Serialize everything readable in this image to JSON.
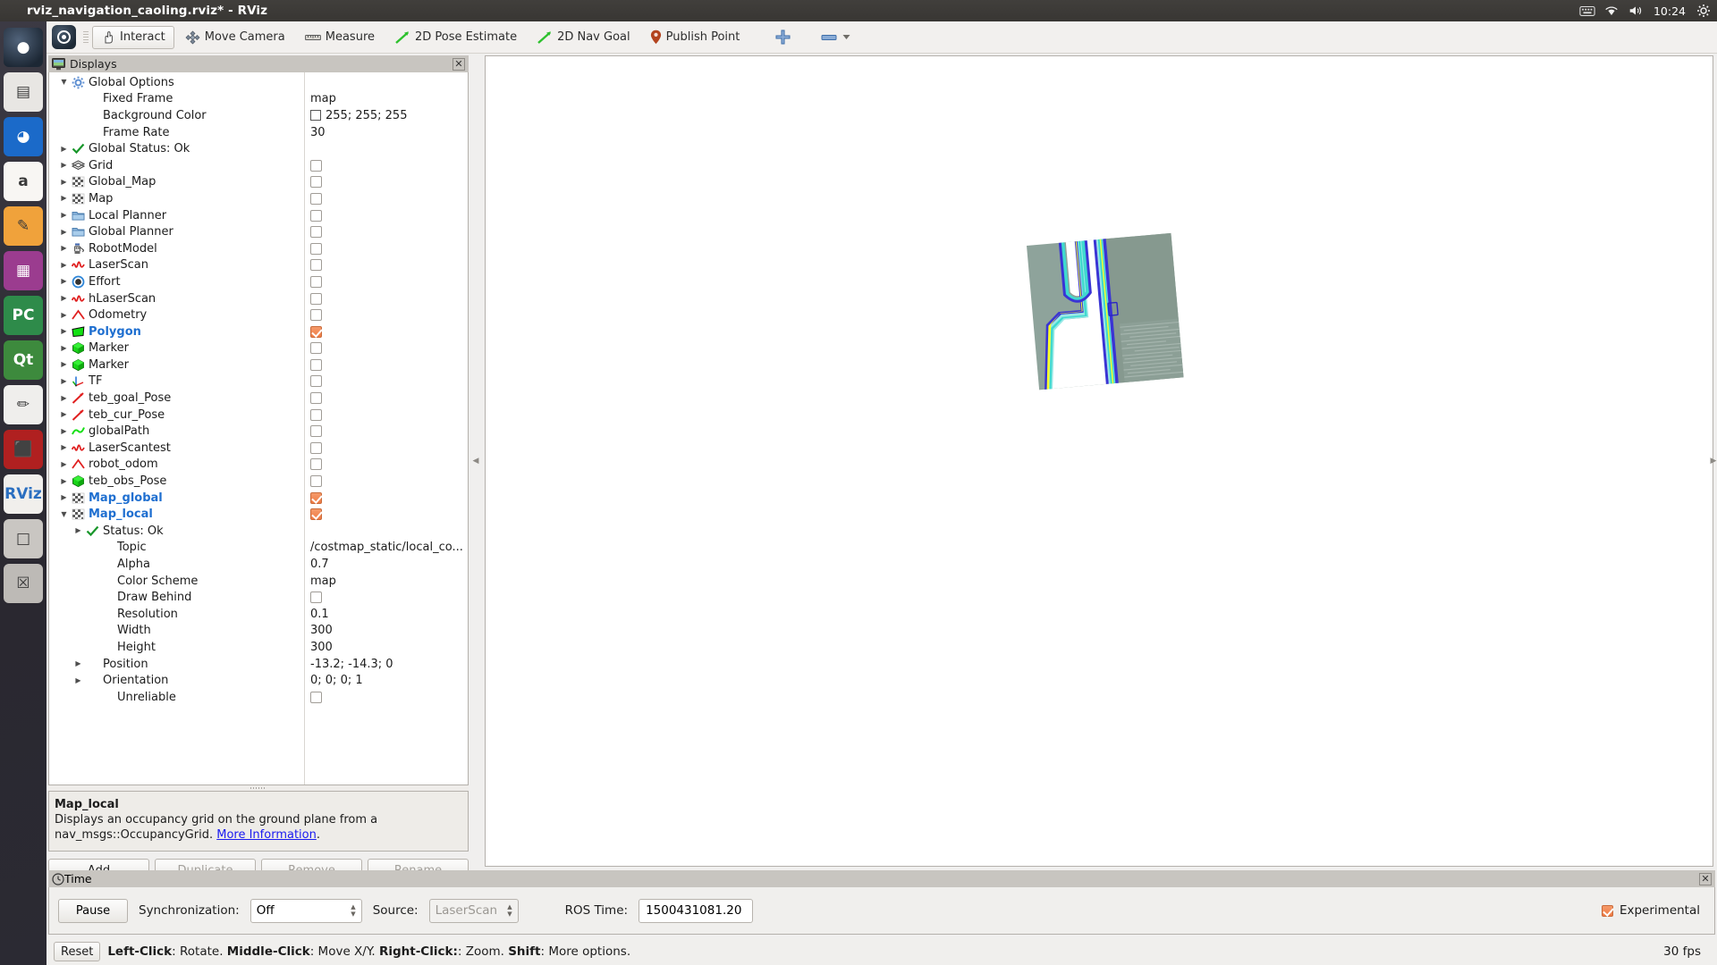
{
  "window": {
    "title": "rviz_navigation_caoling.rviz* - RViz",
    "clock": "10:24"
  },
  "launcher": {
    "items": [
      {
        "name": "ubuntu-dash",
        "label": "●",
        "color": "#3c3b37"
      },
      {
        "name": "files",
        "label": "▤",
        "color": "#e8e6e3"
      },
      {
        "name": "firefox",
        "label": "◕",
        "color": "#1b6ac9"
      },
      {
        "name": "amazon",
        "label": "a",
        "color": "#f8f6f3"
      },
      {
        "name": "software-center",
        "label": "✎",
        "color": "#f0a23b"
      },
      {
        "name": "gallery",
        "label": "▦",
        "color": "#9b3c8f"
      },
      {
        "name": "pycharm",
        "label": "PC",
        "color": "#2e8b4a"
      },
      {
        "name": "qt-creator",
        "label": "Qt",
        "color": "#3d8a3d"
      },
      {
        "name": "text-editor",
        "label": "✏",
        "color": "#efeeec"
      },
      {
        "name": "terminal",
        "label": "⬛",
        "color": "#b02020"
      },
      {
        "name": "rviz-app",
        "label": "RViz",
        "color": "#e9e7e4"
      },
      {
        "name": "archive",
        "label": "□",
        "color": "#c9c6c2"
      },
      {
        "name": "trash",
        "label": "☒",
        "color": "#bdbab6"
      }
    ]
  },
  "toolbar": {
    "buttons": [
      {
        "name": "interact",
        "label": "Interact",
        "icon": "hand-icon",
        "active": true
      },
      {
        "name": "move-camera",
        "label": "Move Camera",
        "icon": "move-camera-icon",
        "active": false
      },
      {
        "name": "measure",
        "label": "Measure",
        "icon": "ruler-icon",
        "active": false
      },
      {
        "name": "2d-pose-estimate",
        "label": "2D Pose Estimate",
        "icon": "arrow-green-icon",
        "active": false
      },
      {
        "name": "2d-nav-goal",
        "label": "2D Nav Goal",
        "icon": "arrow-green-icon",
        "active": false
      },
      {
        "name": "publish-point",
        "label": "Publish Point",
        "icon": "map-pin-icon",
        "active": false
      }
    ],
    "add_tool_icon": "plus-icon",
    "remove_tool_icon": "minus-icon",
    "remove_dropdown_icon": "chevron-down-icon"
  },
  "displays_panel": {
    "title": "Displays",
    "title_icon": "monitor-icon",
    "close_icon": "close-icon",
    "rows": [
      {
        "indent": 0,
        "arrow": "down",
        "icon": "gear-icon",
        "label": "Global Options",
        "highlight": false,
        "value_type": "none"
      },
      {
        "indent": 1,
        "arrow": "none",
        "icon": "none",
        "label": "Fixed Frame",
        "highlight": false,
        "value_type": "text",
        "value": "map"
      },
      {
        "indent": 1,
        "arrow": "none",
        "icon": "none",
        "label": "Background Color",
        "highlight": false,
        "value_type": "color",
        "value": "255; 255; 255",
        "color": "#ffffff"
      },
      {
        "indent": 1,
        "arrow": "none",
        "icon": "none",
        "label": "Frame Rate",
        "highlight": false,
        "value_type": "text",
        "value": "30"
      },
      {
        "indent": 0,
        "arrow": "right",
        "icon": "check-icon",
        "label": "Global Status: Ok",
        "highlight": false,
        "value_type": "none"
      },
      {
        "indent": 0,
        "arrow": "right",
        "icon": "grid-icon",
        "label": "Grid",
        "highlight": false,
        "value_type": "checkbox",
        "checked": false
      },
      {
        "indent": 0,
        "arrow": "right",
        "icon": "map-icon",
        "label": "Global_Map",
        "highlight": false,
        "value_type": "checkbox",
        "checked": false
      },
      {
        "indent": 0,
        "arrow": "right",
        "icon": "map-icon",
        "label": "Map",
        "highlight": false,
        "value_type": "checkbox",
        "checked": false
      },
      {
        "indent": 0,
        "arrow": "right",
        "icon": "folder-icon",
        "label": "Local Planner",
        "highlight": false,
        "value_type": "checkbox",
        "checked": false
      },
      {
        "indent": 0,
        "arrow": "right",
        "icon": "folder-icon",
        "label": "Global Planner",
        "highlight": false,
        "value_type": "checkbox",
        "checked": false
      },
      {
        "indent": 0,
        "arrow": "right",
        "icon": "robot-icon",
        "label": "RobotModel",
        "highlight": false,
        "value_type": "checkbox",
        "checked": false
      },
      {
        "indent": 0,
        "arrow": "right",
        "icon": "laserscan-icon",
        "label": "LaserScan",
        "highlight": false,
        "value_type": "checkbox",
        "checked": false
      },
      {
        "indent": 0,
        "arrow": "right",
        "icon": "effort-icon",
        "label": "Effort",
        "highlight": false,
        "value_type": "checkbox",
        "checked": false
      },
      {
        "indent": 0,
        "arrow": "right",
        "icon": "laserscan-icon",
        "label": "hLaserScan",
        "highlight": false,
        "value_type": "checkbox",
        "checked": false
      },
      {
        "indent": 0,
        "arrow": "right",
        "icon": "odometry-icon",
        "label": "Odometry",
        "highlight": false,
        "value_type": "checkbox",
        "checked": false
      },
      {
        "indent": 0,
        "arrow": "right",
        "icon": "polygon-icon",
        "label": "Polygon",
        "highlight": true,
        "value_type": "checkbox",
        "checked": true
      },
      {
        "indent": 0,
        "arrow": "right",
        "icon": "marker-icon",
        "label": "Marker",
        "highlight": false,
        "value_type": "checkbox",
        "checked": false
      },
      {
        "indent": 0,
        "arrow": "right",
        "icon": "marker-icon",
        "label": "Marker",
        "highlight": false,
        "value_type": "checkbox",
        "checked": false
      },
      {
        "indent": 0,
        "arrow": "right",
        "icon": "tf-icon",
        "label": "TF",
        "highlight": false,
        "value_type": "checkbox",
        "checked": false
      },
      {
        "indent": 0,
        "arrow": "right",
        "icon": "pose-icon",
        "label": "teb_goal_Pose",
        "highlight": false,
        "value_type": "checkbox",
        "checked": false
      },
      {
        "indent": 0,
        "arrow": "right",
        "icon": "pose-icon",
        "label": "teb_cur_Pose",
        "highlight": false,
        "value_type": "checkbox",
        "checked": false
      },
      {
        "indent": 0,
        "arrow": "right",
        "icon": "path-icon",
        "label": "globalPath",
        "highlight": false,
        "value_type": "checkbox",
        "checked": false
      },
      {
        "indent": 0,
        "arrow": "right",
        "icon": "laserscan-icon",
        "label": "LaserScantest",
        "highlight": false,
        "value_type": "checkbox",
        "checked": false
      },
      {
        "indent": 0,
        "arrow": "right",
        "icon": "odometry-icon",
        "label": "robot_odom",
        "highlight": false,
        "value_type": "checkbox",
        "checked": false
      },
      {
        "indent": 0,
        "arrow": "right",
        "icon": "marker-icon",
        "label": "teb_obs_Pose",
        "highlight": false,
        "value_type": "checkbox",
        "checked": false
      },
      {
        "indent": 0,
        "arrow": "right",
        "icon": "map-icon",
        "label": "Map_global",
        "highlight": true,
        "value_type": "checkbox",
        "checked": true
      },
      {
        "indent": 0,
        "arrow": "down",
        "icon": "map-icon",
        "label": "Map_local",
        "highlight": true,
        "value_type": "checkbox",
        "checked": true
      },
      {
        "indent": 1,
        "arrow": "right",
        "icon": "check-icon",
        "label": "Status: Ok",
        "highlight": false,
        "value_type": "none"
      },
      {
        "indent": 2,
        "arrow": "none",
        "icon": "none",
        "label": "Topic",
        "highlight": false,
        "value_type": "text",
        "value": "/costmap_static/local_co..."
      },
      {
        "indent": 2,
        "arrow": "none",
        "icon": "none",
        "label": "Alpha",
        "highlight": false,
        "value_type": "text",
        "value": "0.7"
      },
      {
        "indent": 2,
        "arrow": "none",
        "icon": "none",
        "label": "Color Scheme",
        "highlight": false,
        "value_type": "text",
        "value": "map"
      },
      {
        "indent": 2,
        "arrow": "none",
        "icon": "none",
        "label": "Draw Behind",
        "highlight": false,
        "value_type": "checkbox",
        "checked": false
      },
      {
        "indent": 2,
        "arrow": "none",
        "icon": "none",
        "label": "Resolution",
        "highlight": false,
        "value_type": "text",
        "value": "0.1"
      },
      {
        "indent": 2,
        "arrow": "none",
        "icon": "none",
        "label": "Width",
        "highlight": false,
        "value_type": "text",
        "value": "300"
      },
      {
        "indent": 2,
        "arrow": "none",
        "icon": "none",
        "label": "Height",
        "highlight": false,
        "value_type": "text",
        "value": "300"
      },
      {
        "indent": 1,
        "arrow": "right",
        "icon": "none",
        "label": "Position",
        "highlight": false,
        "value_type": "text",
        "value": "-13.2; -14.3; 0"
      },
      {
        "indent": 1,
        "arrow": "right",
        "icon": "none",
        "label": "Orientation",
        "highlight": false,
        "value_type": "text",
        "value": "0; 0; 0; 1"
      },
      {
        "indent": 2,
        "arrow": "none",
        "icon": "none",
        "label": "Unreliable",
        "highlight": false,
        "value_type": "checkbox",
        "checked": false
      }
    ],
    "description": {
      "title": "Map_local",
      "text_before": "Displays an occupancy grid on the ground plane from a nav_msgs::OccupancyGrid. ",
      "link": "More Information",
      "text_after": "."
    },
    "buttons": [
      {
        "name": "add-display-button",
        "label": "Add",
        "disabled": false
      },
      {
        "name": "duplicate-display-button",
        "label": "Duplicate",
        "disabled": true
      },
      {
        "name": "remove-display-button",
        "label": "Remove",
        "disabled": true
      },
      {
        "name": "rename-display-button",
        "label": "Rename",
        "disabled": true
      }
    ]
  },
  "time_panel": {
    "title": "Time",
    "title_icon": "clock-icon",
    "pause_label": "Pause",
    "sync_label": "Synchronization:",
    "sync_value": "Off",
    "source_label": "Source:",
    "source_value": "LaserScan",
    "ros_time_label": "ROS Time:",
    "ros_time_value": "1500431081.20",
    "experimental_label": "Experimental",
    "experimental_checked": true
  },
  "statusbar": {
    "reset_label": "Reset",
    "hint_parts": [
      {
        "bold": true,
        "text": "Left-Click"
      },
      {
        "bold": false,
        "text": ": Rotate. "
      },
      {
        "bold": true,
        "text": "Middle-Click"
      },
      {
        "bold": false,
        "text": ": Move X/Y. "
      },
      {
        "bold": true,
        "text": "Right-Click:"
      },
      {
        "bold": false,
        "text": ": Zoom. "
      },
      {
        "bold": true,
        "text": "Shift"
      },
      {
        "bold": false,
        "text": ": More options."
      }
    ],
    "fps": "30 fps"
  },
  "viewport": {
    "background": "#ffffff",
    "costmap": {
      "unknown_color": "#8ea39b",
      "free_color": "#ffffff",
      "lethal_color": "#3a34d4",
      "inscribed_color": "#3fd9cf",
      "inflation_color": "#9ae8e6",
      "centerline_color": "#fbff2a",
      "shadow_color": "#93a7a0"
    }
  }
}
